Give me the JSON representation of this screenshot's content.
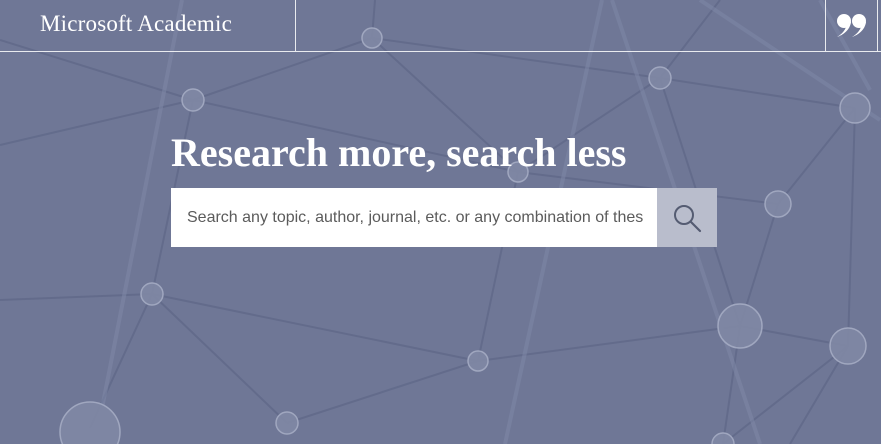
{
  "app": {
    "brand": "Microsoft Academic"
  },
  "header": {
    "quote_icon": "quote-icon"
  },
  "hero": {
    "headline": "Research more, search less"
  },
  "search": {
    "value": "",
    "placeholder": "Search any topic, author, journal, etc. or any combination of these",
    "icon": "search-icon"
  },
  "colors": {
    "background": "#6f7796",
    "search_button": "#b9bdcc",
    "text": "#ffffff"
  }
}
